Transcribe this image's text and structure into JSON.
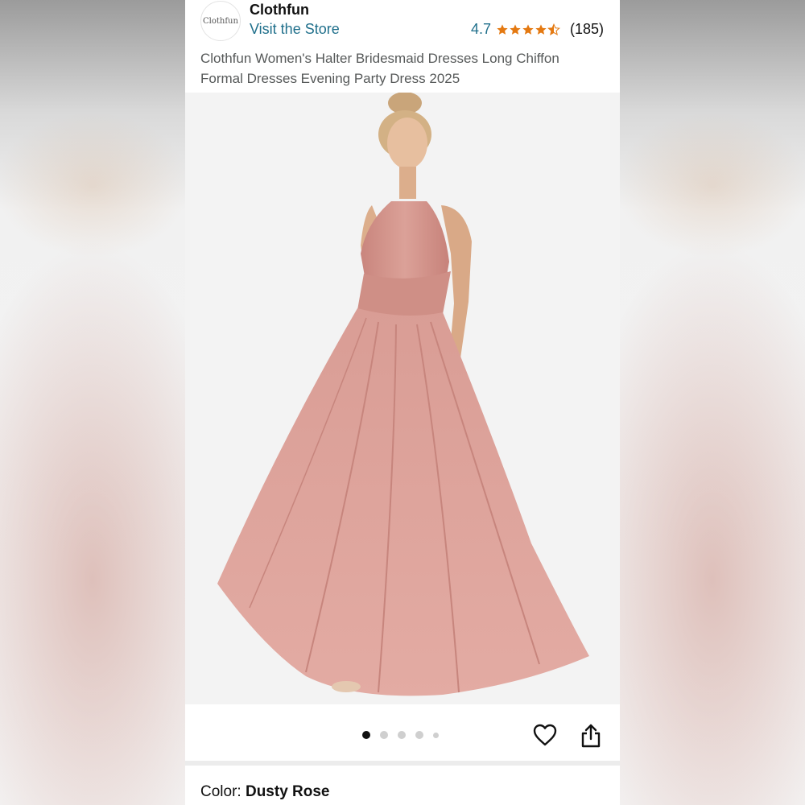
{
  "store": {
    "logo_text": "Clothfun",
    "name": "Clothfun",
    "visit_label": "Visit the Store"
  },
  "rating": {
    "value": "4.7",
    "stars": 4.7,
    "count": "(185)",
    "star_color": "#e47911"
  },
  "product": {
    "title": "Clothfun Women's Halter Bridesmaid Dresses Long Chiffon Formal Dresses Evening Party Dress 2025",
    "image_subject": "dusty rose halter chiffon maxi dress on model"
  },
  "gallery": {
    "dots_total": 5,
    "active_dot": 1
  },
  "actions": {
    "wishlist_icon": "heart-outline-icon",
    "share_icon": "share-icon"
  },
  "color": {
    "label": "Color: ",
    "value": "Dusty Rose",
    "swatch": "#d59a93"
  },
  "colors": {
    "link": "#1f6f8b",
    "text": "#111111",
    "muted": "#565959"
  }
}
